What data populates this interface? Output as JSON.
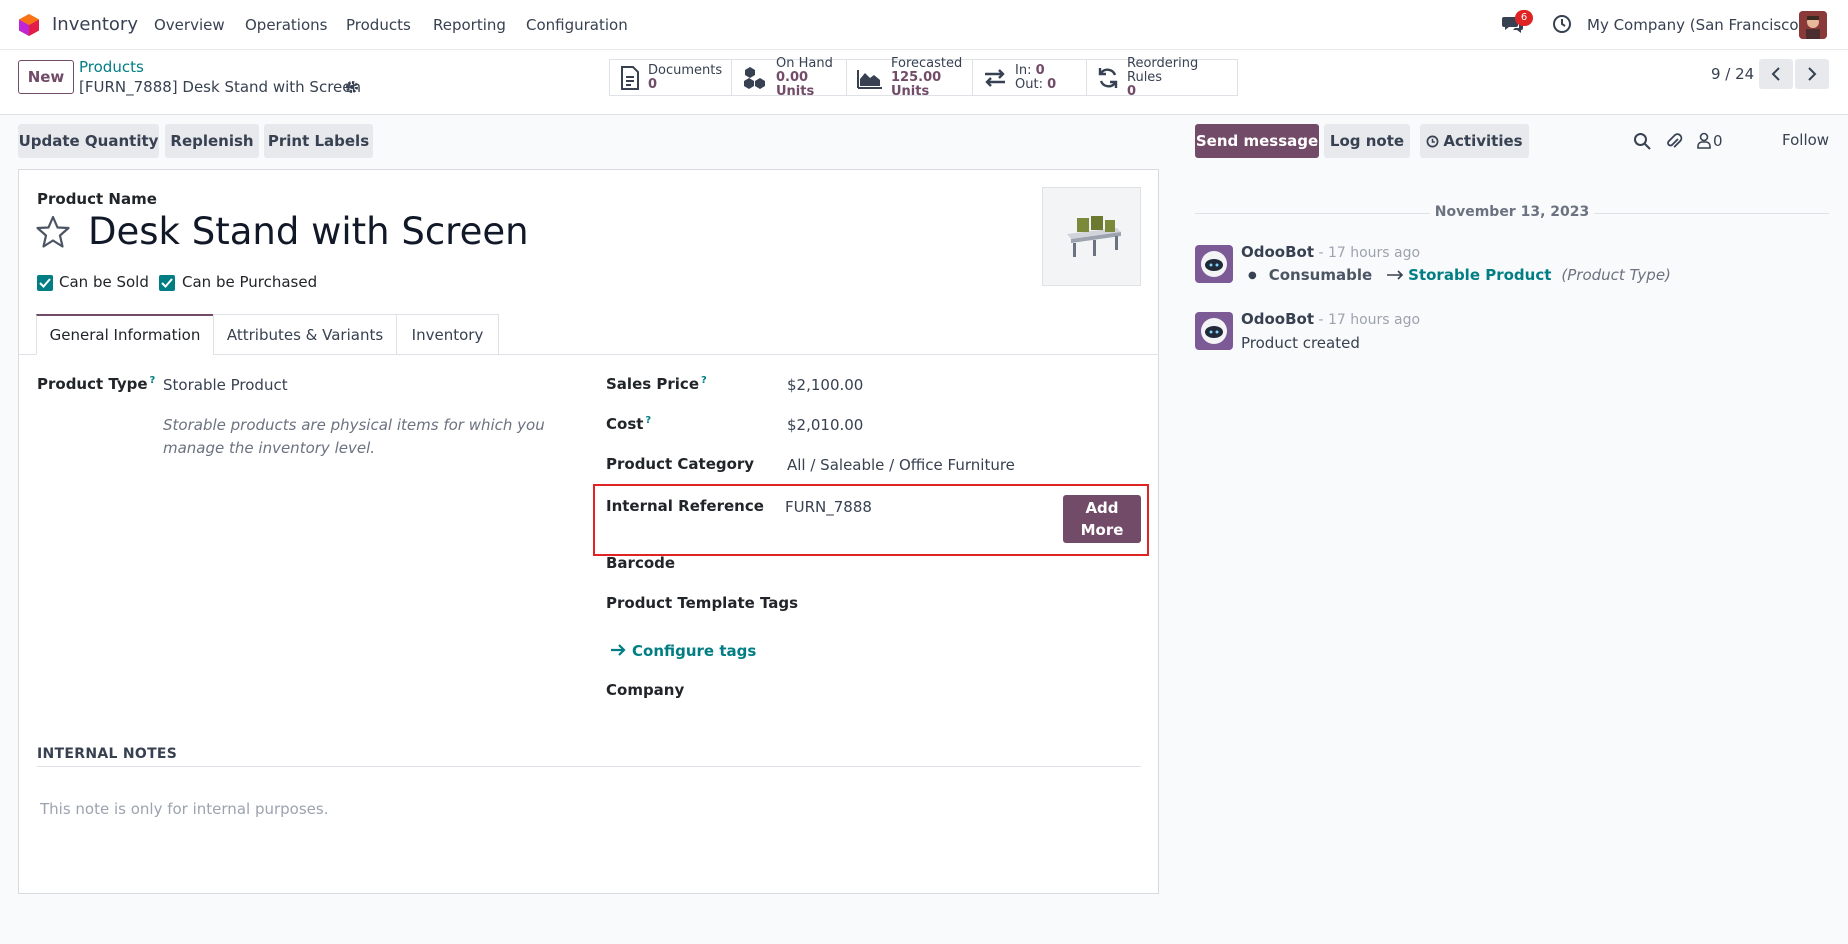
{
  "navbar": {
    "app_name": "Inventory",
    "menu": [
      "Overview",
      "Operations",
      "Products",
      "Reporting",
      "Configuration"
    ],
    "message_count": "6",
    "company": "My Company (San Francisco)"
  },
  "control_panel": {
    "new_label": "New",
    "breadcrumb_parent": "Products",
    "record_title": "[FURN_7888] Desk Stand with Screen",
    "stats": {
      "documents": {
        "label": "Documents",
        "value": "0"
      },
      "on_hand": {
        "label": "On Hand",
        "value": "0.00 Units"
      },
      "forecasted": {
        "label": "Forecasted",
        "value": "125.00 Units"
      },
      "in_out": {
        "in_label": "In:",
        "in_value": "0",
        "out_label": "Out:",
        "out_value": "0"
      },
      "reordering": {
        "label": "Reordering Rules",
        "value": "0"
      }
    },
    "pager": "9 / 24"
  },
  "actions": {
    "update_quantity": "Update Quantity",
    "replenish": "Replenish",
    "print_labels": "Print Labels"
  },
  "form": {
    "product_name_label": "Product Name",
    "product_name": "Desk Stand with Screen",
    "can_be_sold": "Can be Sold",
    "can_be_purchased": "Can be Purchased",
    "tabs": [
      "General Information",
      "Attributes & Variants",
      "Inventory"
    ],
    "product_type_label": "Product Type",
    "product_type_value": "Storable Product",
    "product_type_help": "Storable products are physical items for which you manage the inventory level.",
    "sales_price_label": "Sales Price",
    "sales_price_value": "$2,100.00",
    "cost_label": "Cost",
    "cost_value": "$2,010.00",
    "category_label": "Product Category",
    "category_value": "All / Saleable / Office Furniture",
    "internal_ref_label": "Internal Reference",
    "internal_ref_value": "FURN_7888",
    "add_more_line1": "Add",
    "add_more_line2": "More",
    "barcode_label": "Barcode",
    "tags_label": "Product Template Tags",
    "configure_tags": "Configure tags",
    "company_label": "Company",
    "qmark": "?",
    "notes_title": "INTERNAL NOTES",
    "notes_placeholder": "This note is only for internal purposes."
  },
  "chatter": {
    "send_message": "Send message",
    "log_note": "Log note",
    "activities": "Activities",
    "followers_count": "0",
    "follow": "Follow",
    "date": "November 13, 2023",
    "messages": [
      {
        "author": "OdooBot",
        "time": "- 17 hours ago",
        "change_from": "Consumable",
        "change_to": "Storable Product",
        "field": "(Product Type)"
      },
      {
        "author": "OdooBot",
        "time": "- 17 hours ago",
        "body": "Product created"
      }
    ]
  },
  "colors": {
    "brand": "#714B67",
    "link": "#017e84",
    "highlight": "#e02424"
  }
}
